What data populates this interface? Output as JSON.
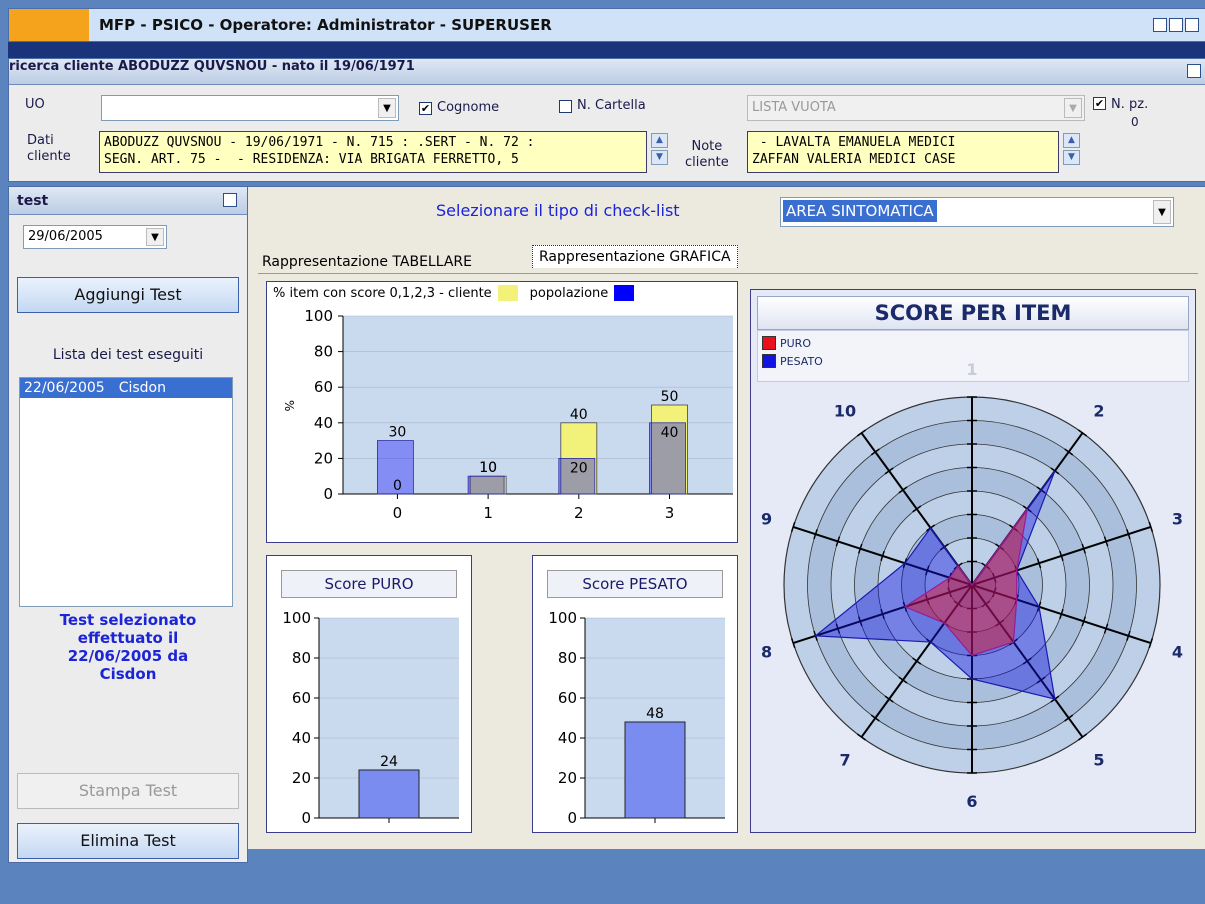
{
  "window": {
    "title": "MFP -  PSICO  - Operatore: Administrator -  SUPERUSER"
  },
  "search": {
    "title": "ricerca cliente ABODUZZ QUVSNOU - nato il 19/06/1971",
    "uo_label": "UO",
    "uo_value": "",
    "cognome_label": "Cognome",
    "cognome_checked": true,
    "ncartella_label": "N. Cartella",
    "ncartella_checked": false,
    "lista_value": "LISTA VUOTA",
    "npz_label": "N. pz.",
    "npz_value": "0",
    "dati_label_1": "Dati",
    "dati_label_2": "cliente",
    "dati_line_1": "ABODUZZ QUVSNOU - 19/06/1971 - N. 715 : .SERT - N. 72 :",
    "dati_line_2": "SEGN. ART. 75 -  - RESIDENZA: VIA BRIGATA FERRETTO, 5",
    "note_label_1": "Note",
    "note_label_2": "cliente",
    "note_line_1": " - LAVALTA EMANUELA MEDICI",
    "note_line_2": "ZAFFAN VALERIA MEDICI CASE"
  },
  "left": {
    "title": "test",
    "date": "29/06/2005",
    "add_button": "Aggiungi Test",
    "list_label": "Lista dei test eseguiti",
    "list_item_date": "22/06/2005",
    "list_item_name": "Cisdon",
    "selected_1": "Test selezionato",
    "selected_2": "effettuato il",
    "selected_3": "22/06/2005 da",
    "selected_4": "Cisdon",
    "print_button": "Stampa Test",
    "delete_button": "Elimina Test"
  },
  "main": {
    "select_label": "Selezionare il tipo di check-list",
    "select_value": "AREA SINTOMATICA",
    "tab_table": "Rappresentazione TABELLARE",
    "tab_graph": "Rappresentazione GRAFICA"
  },
  "colors": {
    "cliente": "#f2f27a",
    "popolazione": "#0000ff",
    "puro": "#e8101c",
    "pesato": "#1414e0"
  },
  "chart_data": [
    {
      "type": "bar",
      "title": "% item con score 0,1,2,3 - cliente",
      "legend_2": "popolazione",
      "ylabel": "%",
      "categories": [
        "0",
        "1",
        "2",
        "3"
      ],
      "series": [
        {
          "name": "cliente",
          "values": [
            0,
            10,
            40,
            50
          ]
        },
        {
          "name": "popolazione",
          "values": [
            30,
            10,
            20,
            40
          ]
        }
      ],
      "ylim": [
        0,
        100
      ],
      "yticks": [
        0,
        20,
        40,
        60,
        80,
        100
      ]
    },
    {
      "type": "bar",
      "title": "Score PURO",
      "values": [
        24
      ],
      "ylim": [
        0,
        100
      ],
      "yticks": [
        0,
        20,
        40,
        60,
        80,
        100
      ]
    },
    {
      "type": "bar",
      "title": "Score PESATO",
      "values": [
        48
      ],
      "ylim": [
        0,
        100
      ],
      "yticks": [
        0,
        20,
        40,
        60,
        80,
        100
      ]
    },
    {
      "type": "radar",
      "title": "SCORE PER ITEM",
      "categories": [
        "1",
        "2",
        "3",
        "4",
        "5",
        "6",
        "7",
        "8",
        "9",
        "10"
      ],
      "rmax": 8,
      "series": [
        {
          "name": "PURO",
          "values": [
            0,
            4,
            2,
            2,
            3,
            3,
            2,
            3,
            1,
            1
          ]
        },
        {
          "name": "PESATO",
          "values": [
            0,
            6,
            2,
            3,
            6,
            4,
            3,
            7,
            3,
            3
          ]
        }
      ]
    }
  ]
}
